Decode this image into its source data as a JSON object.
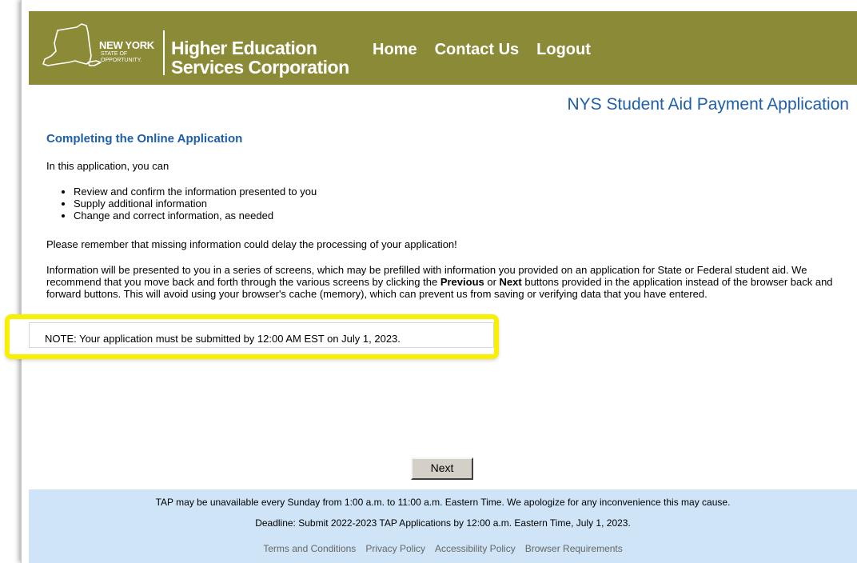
{
  "header": {
    "logo": {
      "state_line1": "NEW YORK",
      "state_line2": "STATE OF",
      "state_line3": "OPPORTUNITY.",
      "agency_line1": "Higher Education",
      "agency_line2": "Services Corporation"
    },
    "nav": [
      {
        "label": "Home"
      },
      {
        "label": "Contact Us"
      },
      {
        "label": "Logout"
      }
    ],
    "background_color": "#8b8a37"
  },
  "page": {
    "app_title": "NYS Student Aid Payment Application",
    "section_heading": "Completing the Online Application",
    "intro": "In this application, you can",
    "bullets": [
      "Review and confirm the information presented to you",
      "Supply additional information",
      "Change and correct information, as needed"
    ],
    "remember": "Please remember that missing information could delay the processing of your application!",
    "info_part1": "Information will be presented to you in a series of screens, which may be prefilled with information you provided on an application for State or Federal student aid. We recommend that you move back and forth through the various screens by clicking the ",
    "info_previous": "Previous",
    "info_or": " or ",
    "info_next": "Next",
    "info_part2": " buttons provided in the application instead of the browser back and forward buttons. This will avoid using your browser's cache (memory), which can prevent us from saving or verifying data that you have entered.",
    "note": "NOTE: Your application must be submitted by 12:00 AM EST on July 1, 2023.",
    "next_button": "Next",
    "title_color": "#1f5ea8",
    "highlight_color": "#f8f000"
  },
  "footer": {
    "notice": "TAP may be unavailable every Sunday from 1:00 a.m. to 11:00 a.m. Eastern Time. We apologize for any inconvenience this may cause.",
    "deadline": "Deadline: Submit 2022-2023 TAP Applications by 12:00 a.m. Eastern Time, July 1, 2023.",
    "links": [
      {
        "label": "Terms and Conditions"
      },
      {
        "label": "Privacy Policy"
      },
      {
        "label": "Accessibility Policy"
      },
      {
        "label": "Browser Requirements"
      }
    ],
    "background_color": "#cfe5f7"
  }
}
